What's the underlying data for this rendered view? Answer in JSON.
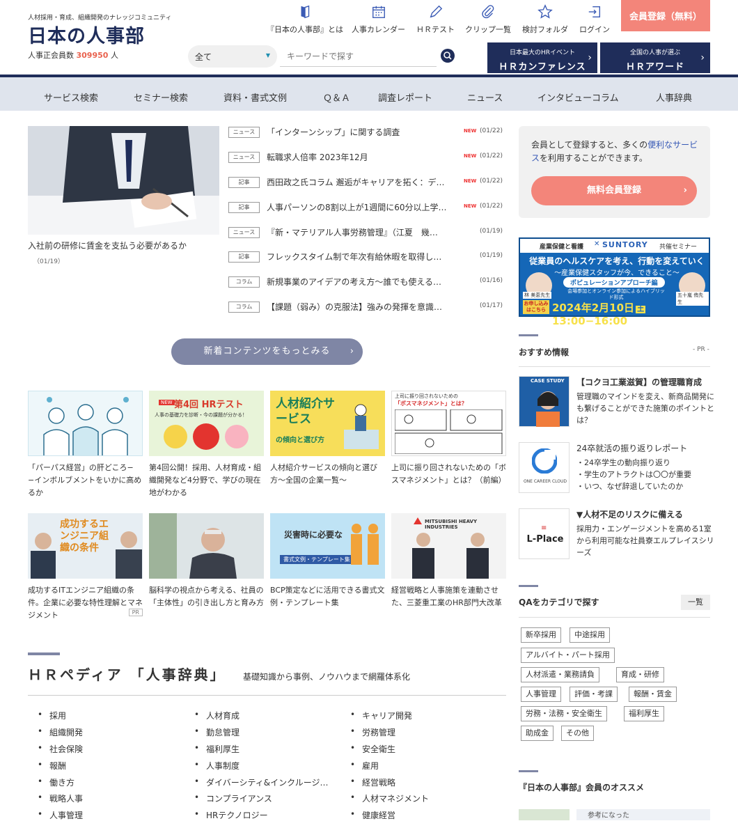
{
  "site": {
    "tagline": "人材採用・育成、組織開発のナレッジコミュニティ",
    "logo": "日本の人事部",
    "member_label": "人事正会員数",
    "member_count": "309950",
    "member_unit": "人"
  },
  "top_nav": [
    {
      "label": "『日本の人事部』とは",
      "icon": "book-icon"
    },
    {
      "label": "人事カレンダー",
      "icon": "calendar-icon"
    },
    {
      "label": "ＨＲテスト",
      "icon": "pen-icon"
    },
    {
      "label": "クリップ一覧",
      "icon": "clip-icon"
    },
    {
      "label": "検討フォルダ",
      "icon": "star-icon"
    },
    {
      "label": "ログイン",
      "icon": "login-icon"
    }
  ],
  "register_button": "会員登録（無料）",
  "search": {
    "category": "全て",
    "placeholder": "キーワードで探す"
  },
  "header_banners": [
    {
      "small": "日本最大のHRイベント",
      "large": "ＨＲカンファレンス"
    },
    {
      "small": "全国の人事が選ぶ",
      "large": "ＨＲアワード"
    }
  ],
  "main_nav": [
    "サービス検索",
    "セミナー検索",
    "資料・書式文例",
    "Ｑ＆Ａ",
    "調査レポート",
    "ニュース",
    "インタビューコラム",
    "人事辞典"
  ],
  "hero": {
    "title": "入社前の研修に賃金を支払う必要があるか",
    "date": "（01/19）"
  },
  "news": [
    {
      "tag": "ニュース",
      "title": "「インターンシップ」に関する調査",
      "new": "NEW",
      "date": "(01/22)"
    },
    {
      "tag": "ニュース",
      "title": "転職求人倍率 2023年12月",
      "new": "NEW",
      "date": "(01/22)"
    },
    {
      "tag": "記事",
      "title": "西田政之氏コラム 邂逅がキャリアを拓く：デ…",
      "new": "NEW",
      "date": "(01/22)"
    },
    {
      "tag": "記事",
      "title": "人事パーソンの8割以上が1週間に60分以上学…",
      "new": "NEW",
      "date": "(01/22)"
    },
    {
      "tag": "ニュース",
      "title": "『新・マテリアル人事労務管理』（江夏　幾…",
      "new": "",
      "date": "(01/19)"
    },
    {
      "tag": "記事",
      "title": "フレックスタイム制で年次有給休暇を取得し…",
      "new": "",
      "date": "(01/19)"
    },
    {
      "tag": "コラム",
      "title": "新規事業のアイデアの考え方〜誰でも使える…",
      "new": "",
      "date": "(01/16)"
    },
    {
      "tag": "コラム",
      "title": "【課題（弱み）の克服法】強みの発揮を意識…",
      "new": "",
      "date": "(01/17)"
    }
  ],
  "more_button": "新着コンテンツをもっとみる",
  "cards_row1": [
    {
      "title": "「パーパス経営」の肝どころ−−インボルブメントをいかに高めるか"
    },
    {
      "title": "第4回公開！採用、人材育成・組織開発など4分野で、学びの現在地がわかる",
      "img_badge": "NEW",
      "img_label": "第4回 HRテスト",
      "img_sub": "人事の基礎力を診断・今の課題が分かる！"
    },
    {
      "title": "人材紹介サービスの傾向と選び方〜全国の企業一覧〜",
      "img_label": "人材紹介サービス",
      "img_sub": "の傾向と選び方"
    },
    {
      "title": "上司に振り回されないための「ボスマネジメント」とは？（前編）",
      "img_label": "「ボスマネジメント」とは？",
      "img_sub": "上司に振り回されないための"
    }
  ],
  "cards_row2": [
    {
      "title": "成功するITエンジニア組織の条件。企業に必要な特性理解とマネジメント",
      "pr": "PR",
      "img_label": "成功するエンジニア組織の条件"
    },
    {
      "title": "脳科学の視点から考える、社員の「主体性」の引き出し方と育み方"
    },
    {
      "title": "BCP策定などに活用できる書式文例・テンプレート集",
      "img_label": "災害時に必要な",
      "img_sub": "書式文例・テンプレート集"
    },
    {
      "title": "経営戦略と人事施策を連動させた、三菱重工業のHR部門大改革",
      "img_label": "MITSUBISHI HEAVY INDUSTRIES"
    }
  ],
  "side_box": {
    "text1": "会員として登録すると、多くの",
    "highlight": "便利なサービス",
    "text2": "を利用することができます。",
    "button": "無料会員登録"
  },
  "seminar_banner": {
    "top_left": "産業保健と看護",
    "brand": "SUNTORY",
    "top_right": "共催セミナー",
    "headline": "従業員のヘルスケアを考え、行動を変えていく",
    "subhead": "〜産業保健スタッフが今、できること〜",
    "chip": "ポピュレーションアプローチ編",
    "format": "会場参加とオンライン参加によるハイブリッド形式",
    "apply": "お申し込みはこちら",
    "date": "2024年2月10日",
    "day": "土",
    "time": "13:00−16:00",
    "speaker1": "林 美恵先生",
    "speaker2": "五十嵐 侑先生"
  },
  "recommend": {
    "heading": "おすすめ情報",
    "pr": "- PR -",
    "items": [
      {
        "title": "【コクヨ工業滋賀】の管理職育成",
        "text": "管理職のマインドを変え、新商品開発にも繋げることができた施策のポイントとは？",
        "img_label": "CASE STUDY"
      },
      {
        "title": "24卒就活の振り返りレポート",
        "text": "・24卒学生の動向振り返り\n・学生のアトラクトは〇〇が重要\n・いつ、なぜ辞退していたのか",
        "img_label": "ONE CAREER CLOUD"
      },
      {
        "title": "▼人材不足のリスクに備える",
        "text": "採用力・エンゲージメントを高める1室から利用可能な社員寮エルプレイスシリーズ",
        "img_label": "L-Place"
      }
    ]
  },
  "qa": {
    "heading": "QAをカテゴリで探す",
    "list_button": "一覧",
    "tags": [
      "新卒採用",
      "中途採用",
      "アルバイト・パート採用",
      "人材派遣・業務請負",
      "育成・研修",
      "人事管理",
      "評価・考課",
      "報酬・賃金",
      "労務・法務・安全衛生",
      "福利厚生",
      "助成金",
      "その他"
    ]
  },
  "member_recommend": {
    "heading": "『日本の人事部』会員のオススメ",
    "snippet": "参考になった"
  },
  "hr_pedia": {
    "title": "ＨＲペディア 「人事辞典」",
    "subtitle": "基礎知識から事例、ノウハウまで網羅体系化",
    "col1": [
      "採用",
      "組織開発",
      "社会保険",
      "報酬",
      "働き方",
      "戦略人事",
      "人事管理"
    ],
    "col2": [
      "人材育成",
      "勤怠管理",
      "福利厚生",
      "人事制度",
      "ダイバーシティ&インクルージ…",
      "コンプライアンス",
      "HRテクノロジー"
    ],
    "col3": [
      "キャリア開発",
      "労務管理",
      "安全衛生",
      "雇用",
      "経営戦略",
      "人材マネジメント",
      "健康経営"
    ]
  },
  "colors": {
    "navy": "#1f2d5a",
    "coral": "#f3857a",
    "slate": "#7f86a5",
    "accent_red": "#e9624e",
    "nav_bg": "#dfe4ed"
  }
}
